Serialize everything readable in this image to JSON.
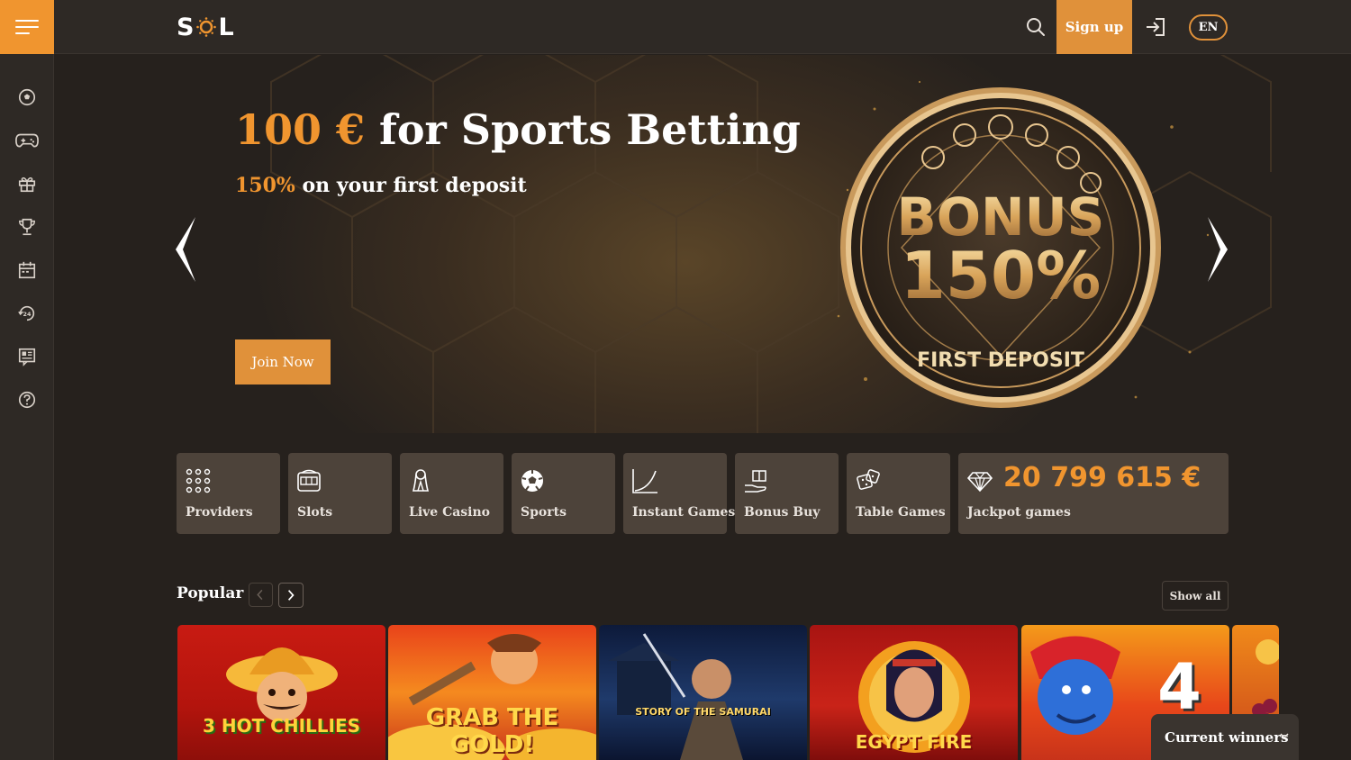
{
  "header": {
    "logo_left": "S",
    "logo_right": "L",
    "signup_label": "Sign up",
    "lang_label": "EN"
  },
  "sidebar": {
    "items": [
      {
        "icon": "soccer-ball-icon"
      },
      {
        "icon": "gamepad-icon"
      },
      {
        "icon": "gift-icon"
      },
      {
        "icon": "trophy-icon"
      },
      {
        "icon": "calendar-icon"
      },
      {
        "icon": "support-24-icon"
      },
      {
        "icon": "news-icon"
      },
      {
        "icon": "help-icon"
      }
    ]
  },
  "hero": {
    "title_accent": "100 €",
    "title_rest": " for Sports Betting",
    "subtitle_accent": "150%",
    "subtitle_rest": " on your first deposit",
    "cta_label": "Join Now",
    "coin_line1": "BONUS",
    "coin_line2": "150%",
    "coin_line3": "FIRST DEPOSIT"
  },
  "categories": [
    {
      "label": "Providers",
      "icon": "grid-dots-icon"
    },
    {
      "label": "Slots",
      "icon": "slot-machine-icon"
    },
    {
      "label": "Live Casino",
      "icon": "dealer-icon"
    },
    {
      "label": "Sports",
      "icon": "soccer-ball-icon"
    },
    {
      "label": "Instant Games",
      "icon": "curve-chart-icon"
    },
    {
      "label": "Bonus Buy",
      "icon": "gift-hand-icon"
    },
    {
      "label": "Table Games",
      "icon": "dice-icon"
    }
  ],
  "jackpot": {
    "label": "Jackpot games",
    "amount": "20 799 615 €",
    "icon": "diamond-icon"
  },
  "popular": {
    "title": "Popular",
    "show_all_label": "Show all",
    "games": [
      {
        "title": "3 HOT CHILLIES"
      },
      {
        "title": "GRAB THE GOLD!"
      },
      {
        "title": "STORY OF THE SAMURAI"
      },
      {
        "title": "EGYPT FIRE"
      },
      {
        "title": "4"
      }
    ]
  },
  "winners": {
    "label": "Current winners"
  },
  "colors": {
    "accent": "#f0952f",
    "background": "#26211d",
    "panel": "#2e2925",
    "tile": "#4d433a"
  }
}
